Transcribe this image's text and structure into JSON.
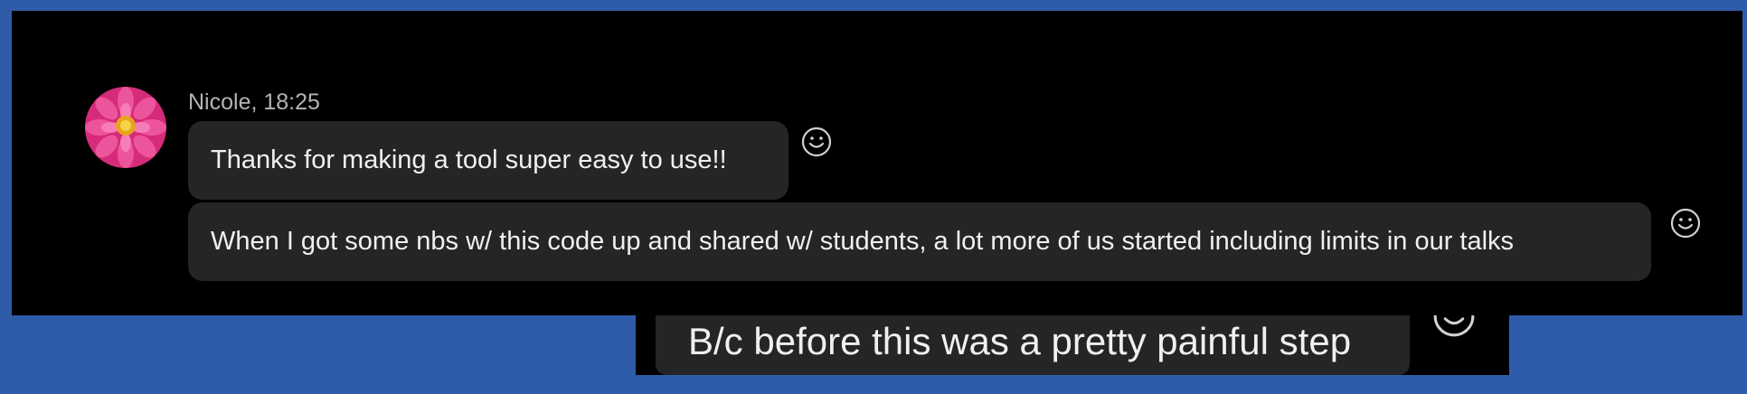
{
  "message_group": {
    "sender": "Nicole",
    "time": "18:25",
    "sender_line": "Nicole, 18:25",
    "avatar": "pink-dahlia-flower-photo"
  },
  "messages": [
    {
      "text": "Thanks for making a tool super easy to use!!",
      "reaction_icon": "smiley-face-icon"
    },
    {
      "text": "When I got some nbs w/ this code up and shared w/ students, a lot more of us started including limits in our talks",
      "reaction_icon": "smiley-face-icon"
    }
  ],
  "zoomed_message": {
    "text": "B/c before this was a pretty painful step",
    "reaction_icon": "smiley-face-icon"
  },
  "colors": {
    "background": "#2f5ca9",
    "chat_background": "#000000",
    "bubble": "#252525",
    "text": "#f0f0f0",
    "meta_text": "#b4b4b4"
  }
}
